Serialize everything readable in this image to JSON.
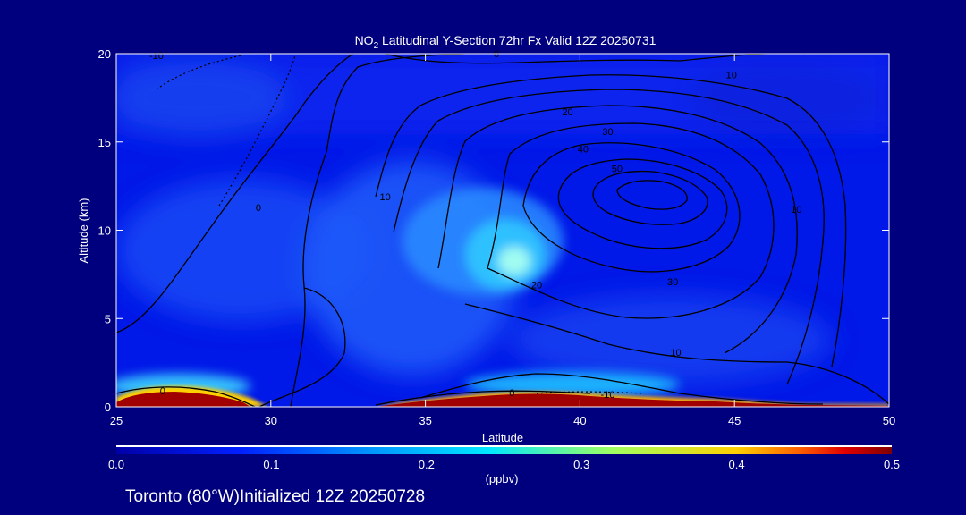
{
  "chart_data": {
    "type": "heatmap",
    "title": "NO2 Latitudinal Y-Section 72hr  Fx Valid 12Z 20250731",
    "title_parts": {
      "pre": "NO",
      "sub": "2",
      "post": " Latitudinal Y-Section 72hr  Fx Valid 12Z 20250731"
    },
    "xlabel": "Latitude",
    "ylabel": "Altitude (km)",
    "xlim": [
      25,
      50
    ],
    "ylim": [
      0,
      20
    ],
    "x_ticks": [
      25,
      30,
      35,
      40,
      45,
      50
    ],
    "x_tick_labels": [
      "25",
      "30",
      "35",
      "40",
      "45",
      "50"
    ],
    "y_ticks": [
      0,
      5,
      10,
      15,
      20
    ],
    "y_tick_labels": [
      "0",
      "5",
      "10",
      "15",
      "20"
    ],
    "colorbar": {
      "min": 0.0,
      "max": 0.5,
      "unit": "(ppbv)",
      "ticks": [
        0.0,
        0.1,
        0.2,
        0.3,
        0.4,
        0.5
      ],
      "tick_labels": [
        "0.0",
        "0.1",
        "0.2",
        "0.3",
        "0.4",
        "0.5"
      ],
      "stops": [
        [
          0.0,
          "#0000a8"
        ],
        [
          0.08,
          "#0020ff"
        ],
        [
          0.16,
          "#0090ff"
        ],
        [
          0.24,
          "#00e8ff"
        ],
        [
          0.32,
          "#a0ff60"
        ],
        [
          0.4,
          "#ffd000"
        ],
        [
          0.44,
          "#ff6000"
        ],
        [
          0.47,
          "#e00000"
        ],
        [
          0.5,
          "#800000"
        ]
      ]
    },
    "contour_labels": [
      {
        "text": "-10",
        "x": 26.3,
        "y": 19.9
      },
      {
        "text": "0",
        "x": 37.3,
        "y": 20.0
      },
      {
        "text": "10",
        "x": 44.9,
        "y": 18.8
      },
      {
        "text": "20",
        "x": 39.6,
        "y": 16.7
      },
      {
        "text": "30",
        "x": 40.9,
        "y": 15.6
      },
      {
        "text": "40",
        "x": 40.1,
        "y": 14.6
      },
      {
        "text": "50",
        "x": 41.2,
        "y": 13.5
      },
      {
        "text": "0",
        "x": 29.6,
        "y": 11.3
      },
      {
        "text": "10",
        "x": 33.7,
        "y": 11.9
      },
      {
        "text": "20",
        "x": 38.6,
        "y": 6.9
      },
      {
        "text": "30",
        "x": 43.0,
        "y": 7.1
      },
      {
        "text": "10",
        "x": 43.1,
        "y": 3.1
      },
      {
        "text": "0",
        "x": 26.5,
        "y": 0.9
      },
      {
        "text": "0",
        "x": 37.8,
        "y": 0.8
      },
      {
        "text": "10",
        "x": 47.0,
        "y": 11.2
      },
      {
        "text": "-10",
        "x": 40.9,
        "y": 0.7
      }
    ]
  },
  "footer": {
    "location": "Toronto (80°W)Initialized 12Z 20250728"
  },
  "colors": {
    "background": "#00007f",
    "plot_base": "#0018e8",
    "contour": "#000000",
    "text": "#ffffff"
  }
}
